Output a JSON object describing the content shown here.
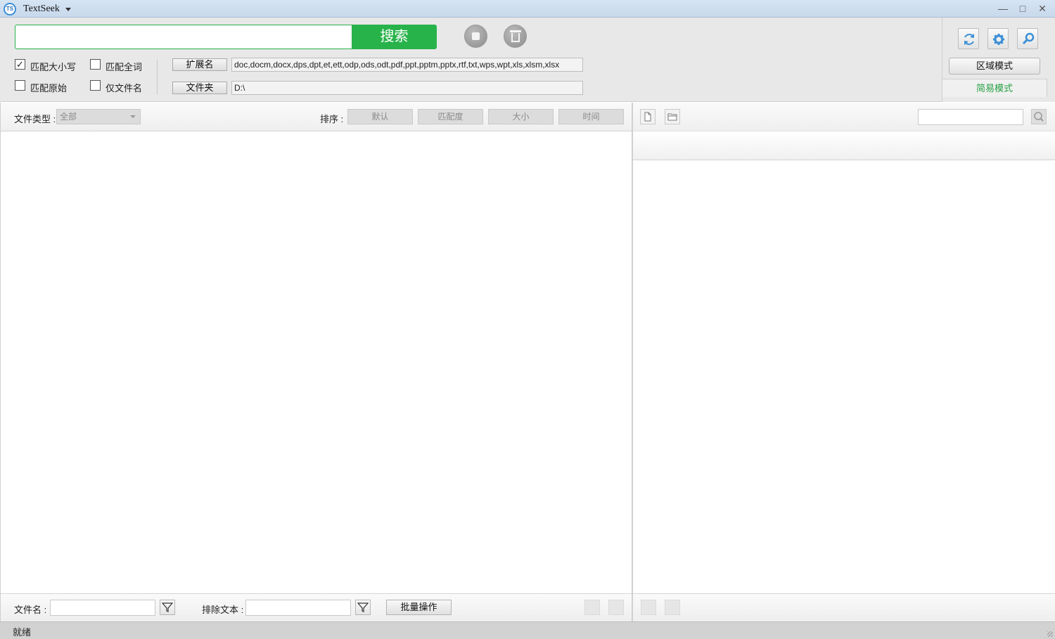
{
  "app": {
    "title": "TextSeek",
    "logo_text": "TS",
    "window_controls": {
      "minimize": "—",
      "maximize": "□",
      "close": "✕"
    }
  },
  "search": {
    "query": "",
    "button_label": "搜索"
  },
  "options": {
    "match_case": {
      "label": "匹配大小写",
      "checked": true
    },
    "match_whole_word": {
      "label": "匹配全词",
      "checked": false
    },
    "match_raw": {
      "label": "匹配原始",
      "checked": false
    },
    "filename_only": {
      "label": "仅文件名",
      "checked": false
    }
  },
  "filters": {
    "extensions_button": "扩展名",
    "extensions_value": "doc,docm,docx,dps,dpt,et,ett,odp,ods,odt,pdf,ppt,pptm,pptx,rtf,txt,wps,wpt,xls,xlsm,xlsx",
    "folder_button": "文件夹",
    "folder_value": "D:\\"
  },
  "modes": {
    "area_mode": "区域模式",
    "simple_mode": "简易模式"
  },
  "results_bar": {
    "file_type_label": "文件类型 :",
    "file_type_value": "全部",
    "sort_label": "排序 :",
    "sort_options": [
      "默认",
      "匹配度",
      "大小",
      "时间"
    ]
  },
  "bottom_bar": {
    "filename_label": "文件名 :",
    "exclude_label": "排除文本 :",
    "batch_button": "批量操作"
  },
  "status": {
    "text": "就绪"
  },
  "colors": {
    "accent_green": "#27b34a",
    "simple_mode_text": "#27a043",
    "tool_icon_blue": "#3b8fd6"
  },
  "icons": {
    "stop": "stop-icon",
    "clear": "trash-icon",
    "refresh": "refresh-icon",
    "settings": "gear-icon",
    "find": "magnifier-icon"
  }
}
